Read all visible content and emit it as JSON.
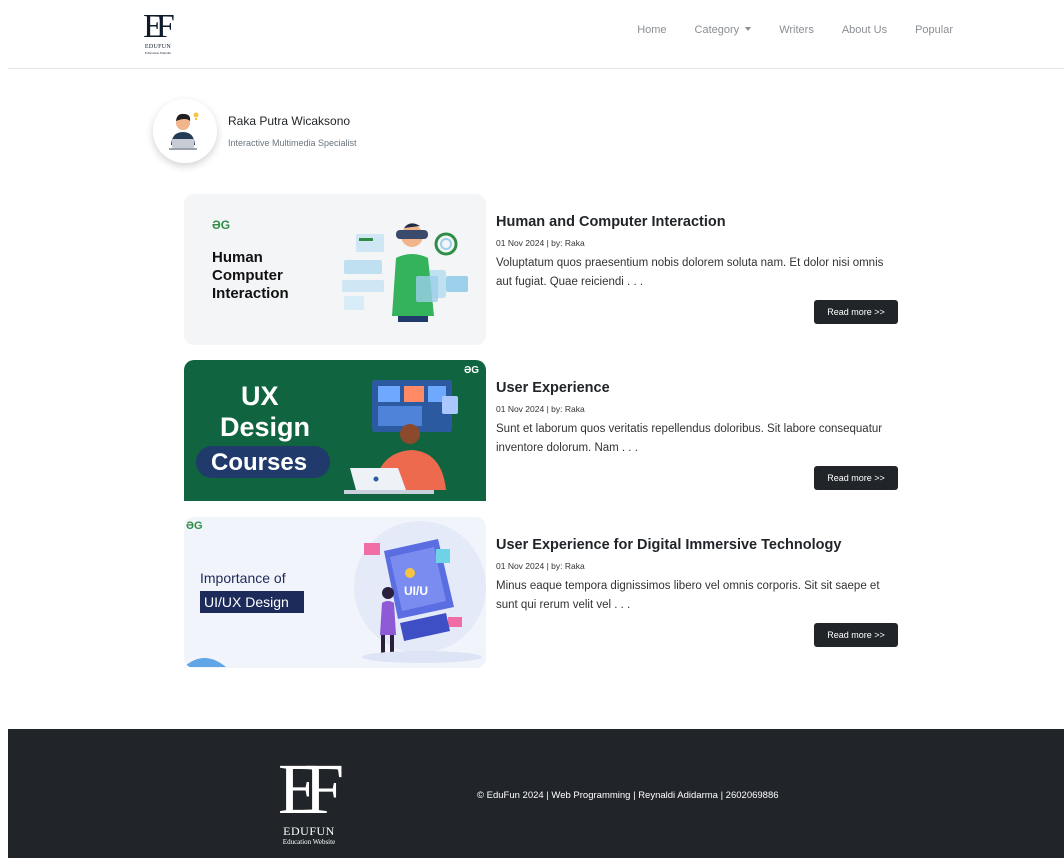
{
  "brand": {
    "mark": "EF",
    "name": "EDUFUN",
    "subtitle": "Education Website"
  },
  "nav": {
    "items": [
      {
        "label": "Home"
      },
      {
        "label": "Category"
      },
      {
        "label": "Writers"
      },
      {
        "label": "About Us"
      },
      {
        "label": "Popular"
      }
    ]
  },
  "profile": {
    "name": "Raka Putra Wicaksono",
    "role": "Interactive Multimedia Specialist"
  },
  "articles": [
    {
      "title": "Human and Computer Interaction",
      "meta": "01 Nov 2024 | by: Raka",
      "excerpt": "Voluptatum quos praesentium nobis dolorem soluta nam. Et dolor nisi omnis aut fugiat. Quae reiciendi . . .",
      "button": "Read more >>",
      "thumb_logo": "ƏG",
      "thumb_lines": [
        "Human",
        "Computer",
        "Interaction"
      ]
    },
    {
      "title": "User Experience",
      "meta": "01 Nov 2024 | by: Raka",
      "excerpt": "Sunt et laborum quos veritatis repellendus doloribus. Sit labore consequatur inventore dolorum. Nam . . .",
      "button": "Read more >>",
      "thumb_logo": "ƏG",
      "thumb_lines": [
        "UX",
        "Design",
        "Courses"
      ]
    },
    {
      "title": "User Experience for Digital Immersive Technology",
      "meta": "01 Nov 2024 | by: Raka",
      "excerpt": "Minus eaque tempora dignissimos libero vel omnis corporis. Sit sit saepe et sunt qui rerum velit vel . . .",
      "button": "Read more >>",
      "thumb_logo": "ƏG",
      "thumb_lines": [
        "Importance of",
        "UI/UX Design"
      ],
      "thumb_screen": "UI/U"
    }
  ],
  "footer": {
    "mark": "EF",
    "name": "EDUFUN",
    "subtitle": "Education Website",
    "copyright": "© EduFun 2024 | Web Programming | Reynaldi Adidarma | 2602069886"
  },
  "colors": {
    "dark": "#212529",
    "gfg_green": "#2f8d46",
    "ux_bg": "#106440",
    "ux_pill": "#1f3a6b",
    "navy_label": "#1c2b5a"
  }
}
